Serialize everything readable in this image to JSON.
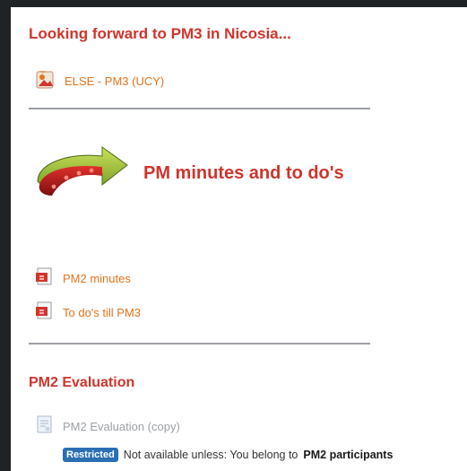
{
  "section1": {
    "title": "Looking forward to PM3 in Nicosia...",
    "resource_label": "ELSE - PM3 (UCY)",
    "resource_icon": "image-file-icon"
  },
  "banner": {
    "text": "PM minutes and to do's",
    "arrow_icon": "curved-arrow-icon"
  },
  "section2": {
    "items": [
      {
        "label": "PM2 minutes",
        "icon": "pdf-icon"
      },
      {
        "label": "To do's till PM3",
        "icon": "pdf-icon"
      }
    ]
  },
  "evaluation": {
    "title": "PM2 Evaluation",
    "activity_label": "PM2 Evaluation (copy)",
    "activity_icon": "feedback-icon",
    "badge_label": "Restricted",
    "restriction_text": "Not available unless: You belong to",
    "restriction_group": "PM2 participants"
  },
  "colors": {
    "accent_red": "#d0342c",
    "link_orange": "#e4731b",
    "badge_blue": "#2a6eb4",
    "muted_gray": "#9ba1a8"
  }
}
